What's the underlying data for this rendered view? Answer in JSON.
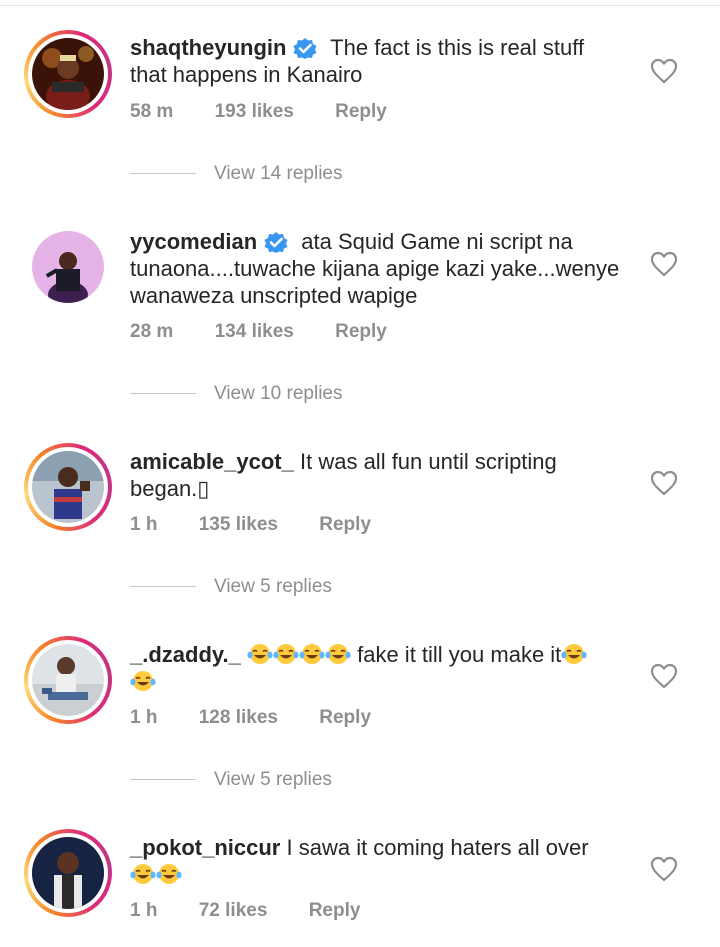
{
  "comments": [
    {
      "username": "shaqtheyungin",
      "verified": true,
      "text": "The fact is this is real stuff that happens in Kanairo",
      "time": "58 m",
      "likes": "193 likes",
      "reply": "Reply",
      "view_replies": "View 14 replies"
    },
    {
      "username": "yycomedian",
      "verified": true,
      "text": "ata Squid Game ni script na tunaona....tuwache kijana apige kazi yake...wenye wanaweza unscripted wapige",
      "time": "28 m",
      "likes": "134 likes",
      "reply": "Reply",
      "view_replies": "View 10 replies"
    },
    {
      "username": "amicable_ycot_",
      "verified": false,
      "text": "It was all fun until scripting began.",
      "text_tail_glyph": "▯",
      "time": "1 h",
      "likes": "135 likes",
      "reply": "Reply",
      "view_replies": "View 5 replies"
    },
    {
      "username": "_.dzaddy._",
      "verified": false,
      "text_mid": "fake it till you make it",
      "emoji": "face-with-tears-of-joy",
      "time": "1 h",
      "likes": "128 likes",
      "reply": "Reply",
      "view_replies": "View 5 replies"
    },
    {
      "username": "_pokot_niccur",
      "verified": false,
      "text": "I sawa it coming haters all over",
      "emoji": "face-with-tears-of-joy",
      "time": "1 h",
      "likes": "72 likes",
      "reply": "Reply"
    }
  ],
  "icons": {
    "like": "heart-outline-icon",
    "verified": "verified-badge-icon"
  },
  "colors": {
    "text": "#262626",
    "secondary": "#8e8e8e",
    "verified": "#3897f0",
    "story_ring": [
      "#f58529",
      "#dd2a7b",
      "#c13584"
    ]
  }
}
